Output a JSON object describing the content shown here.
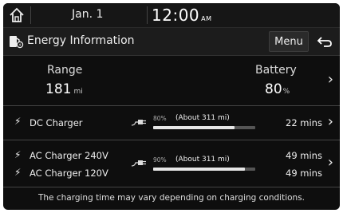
{
  "status": {
    "date": "Jan.  1",
    "time": "12:00",
    "ampm": "AM"
  },
  "header": {
    "title": "Energy Information",
    "menu_label": "Menu"
  },
  "summary": {
    "range_label": "Range",
    "range_value": "181",
    "range_unit": "mi",
    "battery_label": "Battery",
    "battery_value": "80",
    "battery_unit": "%"
  },
  "dc": {
    "label": "DC Charger",
    "percent_text": "80%",
    "about_text": "(About 311 mi)",
    "target_fraction": 0.8,
    "time": "22 mins"
  },
  "ac": {
    "label_240": "AC Charger 240V",
    "label_120": "AC Charger 120V",
    "percent_text": "90%",
    "about_text": "(About 311 mi)",
    "target_fraction": 0.9,
    "time_240": "49 mins",
    "time_120": "49 mins"
  },
  "footer": {
    "note": "The charging time may vary depending on charging conditions."
  },
  "icons": {
    "home": "home-icon",
    "title": "ev-fuel-icon",
    "back": "back-arrow-icon",
    "chevron": "chevron-right-icon",
    "bolt": "lightning-bolt-icon",
    "plug": "charging-plug-icon"
  },
  "colors": {
    "background": "#0e0e0e",
    "text": "#e8e8e8",
    "bar_track": "#555555",
    "bar_fill": "#e6e6e6"
  }
}
